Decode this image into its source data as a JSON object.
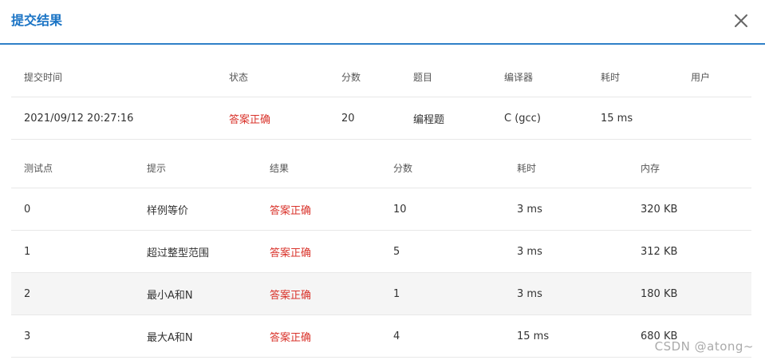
{
  "dialog": {
    "title": "提交结果"
  },
  "icons": {
    "close": "close-icon"
  },
  "summary": {
    "headers": [
      "提交时间",
      "状态",
      "分数",
      "题目",
      "编译器",
      "耗时",
      "用户"
    ],
    "row": [
      "2021/09/12 20:27:16",
      "答案正确",
      "20",
      "编程题",
      "C (gcc)",
      "15 ms",
      ""
    ]
  },
  "cases": {
    "headers": [
      "测试点",
      "提示",
      "结果",
      "分数",
      "耗时",
      "内存"
    ],
    "rows": [
      [
        "0",
        "样例等价",
        "答案正确",
        "10",
        "3 ms",
        "320 KB"
      ],
      [
        "1",
        "超过整型范围",
        "答案正确",
        "5",
        "3 ms",
        "312 KB"
      ],
      [
        "2",
        "最小A和N",
        "答案正确",
        "1",
        "3 ms",
        "180 KB"
      ],
      [
        "3",
        "最大A和N",
        "答案正确",
        "4",
        "15 ms",
        "680 KB"
      ]
    ]
  },
  "watermark": "CSDN @atong~",
  "colors": {
    "accent": "#1b74c5",
    "header_border": "#2f80c8",
    "status_ok": "#d9332b",
    "row_shade": "#f5f5f5"
  }
}
